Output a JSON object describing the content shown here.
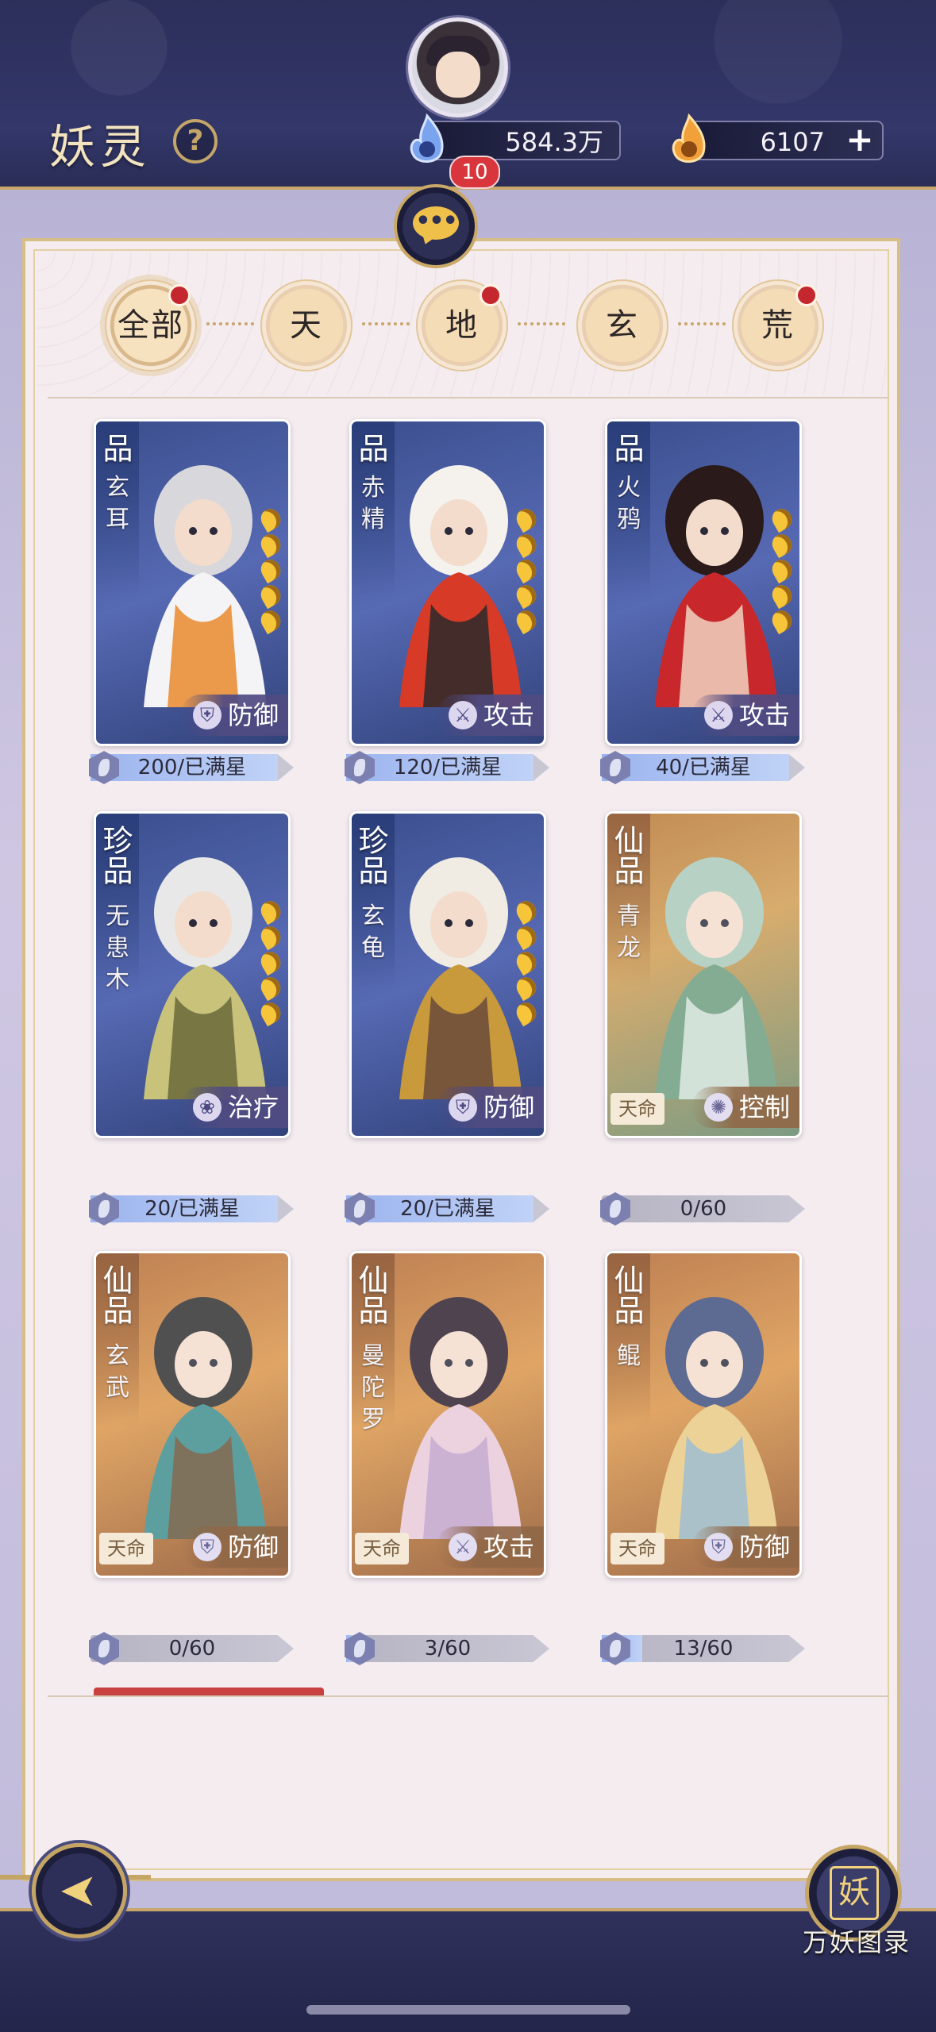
{
  "header": {
    "title": "妖灵",
    "help": "?",
    "currency1": "584.3万",
    "currency2": "6107",
    "plus": "+",
    "chat_badge": "10",
    "chat_dots": "•••"
  },
  "tabs": [
    {
      "label": "全部",
      "dot": true
    },
    {
      "label": "天",
      "dot": false
    },
    {
      "label": "地",
      "dot": true
    },
    {
      "label": "玄",
      "dot": false
    },
    {
      "label": "荒",
      "dot": true
    }
  ],
  "cards": [
    {
      "rarity": "品",
      "name": [
        "玄",
        "耳"
      ],
      "role": "防御",
      "role_icon": "shield-icon",
      "role_glyph": "⛨",
      "progress": "200/已满星",
      "fill": 1.0,
      "fate": ""
    },
    {
      "rarity": "品",
      "name": [
        "赤",
        "精"
      ],
      "role": "攻击",
      "role_icon": "crossed-swords-icon",
      "role_glyph": "⚔",
      "progress": "120/已满星",
      "fill": 1.0,
      "fate": ""
    },
    {
      "rarity": "品",
      "name": [
        "火",
        "鸦"
      ],
      "role": "攻击",
      "role_icon": "crossed-swords-icon",
      "role_glyph": "⚔",
      "progress": "40/已满星",
      "fill": 1.0,
      "fate": ""
    },
    {
      "rarity": "珍品",
      "name": [
        "无",
        "患",
        "木"
      ],
      "role": "治疗",
      "role_icon": "lotus-icon",
      "role_glyph": "❀",
      "progress": "20/已满星",
      "fill": 1.0,
      "fate": ""
    },
    {
      "rarity": "珍品",
      "name": [
        "玄",
        "龟"
      ],
      "role": "防御",
      "role_icon": "shield-icon",
      "role_glyph": "⛨",
      "progress": "20/已满星",
      "fill": 1.0,
      "fate": ""
    },
    {
      "rarity": "仙品",
      "name": [
        "青",
        "龙"
      ],
      "role": "控制",
      "role_icon": "swirl-icon",
      "role_glyph": "✺",
      "progress": "0/60",
      "fill": 0.0,
      "fate": "天命"
    },
    {
      "rarity": "仙品",
      "name": [
        "玄",
        "武"
      ],
      "role": "防御",
      "role_icon": "shield-icon",
      "role_glyph": "⛨",
      "progress": "0/60",
      "fill": 0.0,
      "fate": "天命"
    },
    {
      "rarity": "仙品",
      "name": [
        "曼",
        "陀",
        "罗"
      ],
      "role": "攻击",
      "role_icon": "crossed-swords-icon",
      "role_glyph": "⚔",
      "progress": "3/60",
      "fill": 0.05,
      "fate": "天命"
    },
    {
      "rarity": "仙品",
      "name": [
        "鲲"
      ],
      "role": "防御",
      "role_icon": "shield-icon",
      "role_glyph": "⛨",
      "progress": "13/60",
      "fill": 0.217,
      "fate": "天命"
    }
  ],
  "footer": {
    "back_arrow": "➤",
    "catalog_glyph": "妖",
    "catalog_label": "万妖图录"
  }
}
